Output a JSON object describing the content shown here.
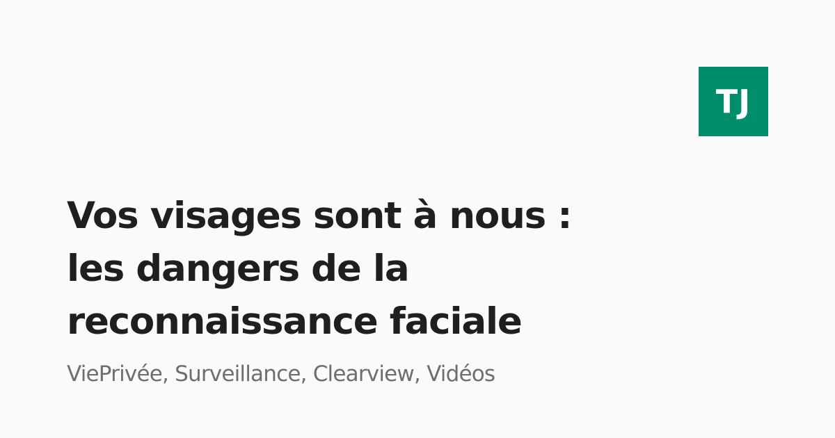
{
  "logo": {
    "text": "TJ",
    "background_color": "#008d6c",
    "text_color": "#ffffff"
  },
  "title": {
    "lines": [
      "Vos visages sont à nous :",
      "les dangers de la",
      "reconnaissance faciale"
    ],
    "color": "#1f1f1f"
  },
  "tags": {
    "text": "ViePrivée, Surveillance, Clearview, Vidéos",
    "color": "#6e6e6e"
  },
  "page": {
    "background_color": "#fafafa"
  }
}
